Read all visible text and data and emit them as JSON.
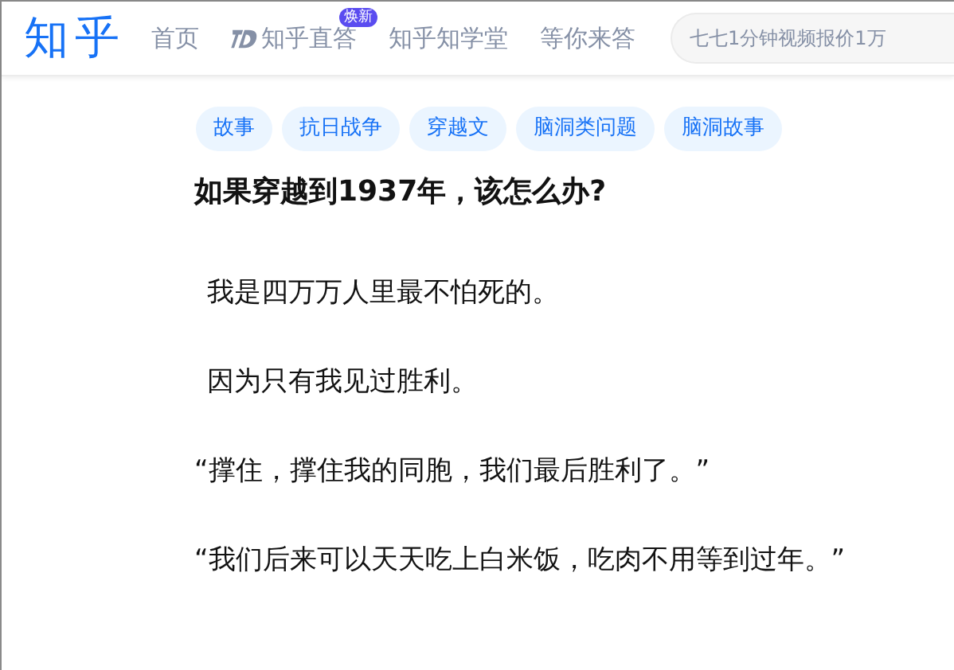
{
  "logo": "知乎",
  "nav": [
    {
      "label": "首页",
      "kind": "plain"
    },
    {
      "label": "知乎直答",
      "kind": "zhida",
      "badge": "焕新"
    },
    {
      "label": "知乎知学堂",
      "kind": "plain"
    },
    {
      "label": "等你来答",
      "kind": "plain"
    }
  ],
  "search": {
    "placeholder": "七七1分钟视频报价1万"
  },
  "tags": [
    "故事",
    "抗日战争",
    "穿越文",
    "脑洞类问题",
    "脑洞故事"
  ],
  "question": {
    "title": "如果穿越到1937年，该怎么办?"
  },
  "paragraphs": [
    {
      "text": "我是四万万人里最不怕死的。",
      "indented": true
    },
    {
      "text": "因为只有我见过胜利。",
      "indented": true
    },
    {
      "text": "“撑住，撑住我的同胞，我们最后胜利了。”",
      "indented": false
    },
    {
      "text": "“我们后来可以天天吃上白米饭，吃肉不用等到过年。”",
      "indented": false
    }
  ]
}
